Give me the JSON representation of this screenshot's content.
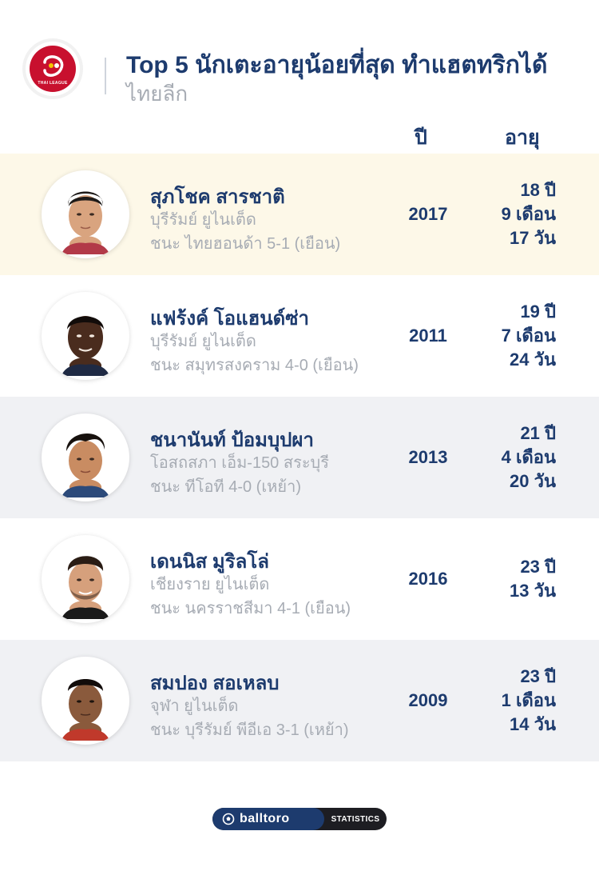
{
  "header": {
    "logo_text": "THAI LEAGUE",
    "title": "Top 5 นักเตะอายุน้อยที่สุด ทำแฮตทริกได้",
    "subtitle": "ไทยลีก"
  },
  "columns": {
    "year": "ปี",
    "age": "อายุ"
  },
  "players": [
    {
      "name": "สุภโชค สารชาติ",
      "club": "บุรีรัมย์ ยูไนเต็ด",
      "match": "ชนะ ไทยฮอนด้า 5-1 (เยือน)",
      "year": "2017",
      "age_lines": [
        "18 ปี",
        "9 เดือน",
        "17 วัน"
      ]
    },
    {
      "name": "แฟร้งค์ โอแฮนด์ซ่า",
      "club": "บุรีรัมย์ ยูไนเต็ด",
      "match": "ชนะ สมุทรสงคราม 4-0 (เยือน)",
      "year": "2011",
      "age_lines": [
        "19 ปี",
        "7 เดือน",
        "24 วัน"
      ]
    },
    {
      "name": "ชนานันท์ ป้อมบุปผา",
      "club": "โอสถสภา เอ็ม-150 สระบุรี",
      "match": "ชนะ ทีโอที 4-0 (เหย้า)",
      "year": "2013",
      "age_lines": [
        "21 ปี",
        "4 เดือน",
        "20 วัน"
      ]
    },
    {
      "name": "เดนนิส มูริลโล่",
      "club": "เชียงราย ยูไนเต็ด",
      "match": "ชนะ นครราชสีมา 4-1 (เยือน)",
      "year": "2016",
      "age_lines": [
        "23 ปี",
        "13 วัน"
      ]
    },
    {
      "name": "สมปอง สอเหลบ",
      "club": "จุฬา ยูไนเต็ด",
      "match": "ชนะ บุรีรัมย์ พีอีเอ 3-1 (เหย้า)",
      "year": "2009",
      "age_lines": [
        "23 ปี",
        "1 เดือน",
        "14 วัน"
      ]
    }
  ],
  "footer": {
    "brand": "balltoro",
    "tag": "STATISTICS"
  },
  "colors": {
    "primary": "#1d3b6e",
    "muted": "#a7acb4",
    "highlight_row": "#fdf8e8",
    "grey_row": "#f0f1f4",
    "logo_red": "#c8102e"
  }
}
